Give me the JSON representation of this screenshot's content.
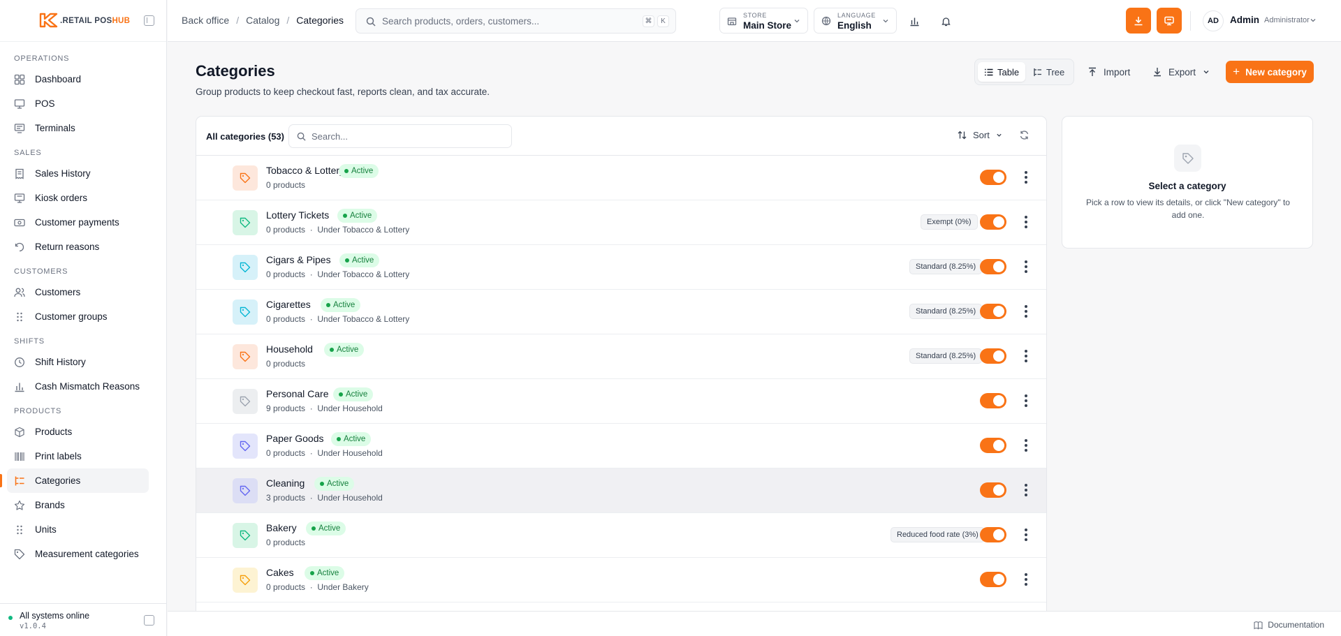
{
  "brand": {
    "logo_text_a": ".RETAIL POS",
    "logo_text_b": "HUB",
    "accent": "#f97316"
  },
  "sidebar": {
    "sections": [
      {
        "label": "OPERATIONS",
        "items": [
          {
            "label": "Dashboard",
            "icon": "dashboard-icon"
          },
          {
            "label": "POS",
            "icon": "monitor-icon"
          },
          {
            "label": "Terminals",
            "icon": "terminal-icon"
          }
        ]
      },
      {
        "label": "SALES",
        "items": [
          {
            "label": "Sales History",
            "icon": "receipt-icon"
          },
          {
            "label": "Kiosk orders",
            "icon": "kiosk-icon"
          },
          {
            "label": "Customer payments",
            "icon": "payment-icon"
          },
          {
            "label": "Return reasons",
            "icon": "return-icon"
          }
        ]
      },
      {
        "label": "CUSTOMERS",
        "items": [
          {
            "label": "Customers",
            "icon": "users-icon"
          },
          {
            "label": "Customer groups",
            "icon": "grid-icon"
          }
        ]
      },
      {
        "label": "SHIFTS",
        "items": [
          {
            "label": "Shift History",
            "icon": "clock-icon"
          },
          {
            "label": "Cash Mismatch Reasons",
            "icon": "bar-chart-icon"
          }
        ]
      },
      {
        "label": "PRODUCTS",
        "items": [
          {
            "label": "Products",
            "icon": "box-icon"
          },
          {
            "label": "Print labels",
            "icon": "barcode-icon"
          },
          {
            "label": "Categories",
            "icon": "tree-icon",
            "active": true
          },
          {
            "label": "Brands",
            "icon": "star-icon"
          },
          {
            "label": "Units",
            "icon": "grid-icon"
          },
          {
            "label": "Measurement categories",
            "icon": "tag-icon"
          }
        ]
      }
    ],
    "status": "All systems online",
    "version": "v1.0.4"
  },
  "topbar": {
    "breadcrumb": [
      "Back office",
      "Catalog",
      "Categories"
    ],
    "search_placeholder": "Search products, orders, customers...",
    "kbd_1": "⌘",
    "kbd_2": "K",
    "store_label": "STORE",
    "store_value": "Main Store",
    "language_label": "LANGUAGE",
    "language_value": "English",
    "user_initials": "AD",
    "user_name": "Admin",
    "user_role": "Administrator"
  },
  "page": {
    "title": "Categories",
    "subtitle": "Group products to keep checkout fast, reports clean, and tax accurate.",
    "view_table": "Table",
    "view_tree": "Tree",
    "import_label": "Import",
    "export_label": "Export",
    "new_label": "New category"
  },
  "list": {
    "title": "All categories (53)",
    "search_placeholder": "Search...",
    "sort_label": "Sort",
    "rows": [
      {
        "name": "Tobacco & Lottery",
        "status": "Active",
        "meta": "0 products",
        "parent": "",
        "tax": "",
        "color": "#fde7dc",
        "icon_color": "#f97316"
      },
      {
        "name": "Lottery Tickets",
        "status": "Active",
        "meta": "0 products",
        "parent": "Under Tobacco & Lottery",
        "tax": "Exempt (0%)",
        "color": "#d8f5e6",
        "icon_color": "#10b981"
      },
      {
        "name": "Cigars & Pipes",
        "status": "Active",
        "meta": "0 products",
        "parent": "Under Tobacco & Lottery",
        "tax": "Standard (8.25%)",
        "color": "#d6f1f9",
        "icon_color": "#06b6d4"
      },
      {
        "name": "Cigarettes",
        "status": "Active",
        "meta": "0 products",
        "parent": "Under Tobacco & Lottery",
        "tax": "Standard (8.25%)",
        "color": "#d6f1f9",
        "icon_color": "#06b6d4"
      },
      {
        "name": "Household",
        "status": "Active",
        "meta": "0 products",
        "parent": "",
        "tax": "Standard (8.25%)",
        "color": "#fde7dc",
        "icon_color": "#f97316"
      },
      {
        "name": "Personal Care",
        "status": "Active",
        "meta": "9 products",
        "parent": "Under Household",
        "tax": "",
        "color": "#eceef0",
        "icon_color": "#9ca3af"
      },
      {
        "name": "Paper Goods",
        "status": "Active",
        "meta": "0 products",
        "parent": "Under Household",
        "tax": "",
        "color": "#e3e5fb",
        "icon_color": "#6366f1"
      },
      {
        "name": "Cleaning",
        "status": "Active",
        "meta": "3 products",
        "parent": "Under Household",
        "tax": "",
        "color": "#dcdef5",
        "icon_color": "#6366f1"
      },
      {
        "name": "Bakery",
        "status": "Active",
        "meta": "0 products",
        "parent": "",
        "tax": "Reduced food rate (3%)",
        "color": "#d8f5e6",
        "icon_color": "#10b981"
      },
      {
        "name": "Cakes",
        "status": "Active",
        "meta": "0 products",
        "parent": "Under Bakery",
        "tax": "",
        "color": "#fdf3d3",
        "icon_color": "#f59e0b"
      }
    ]
  },
  "detail": {
    "title": "Select a category",
    "text": "Pick a row to view its details, or click \"New category\" to add one."
  },
  "footer": {
    "documentation": "Documentation"
  }
}
